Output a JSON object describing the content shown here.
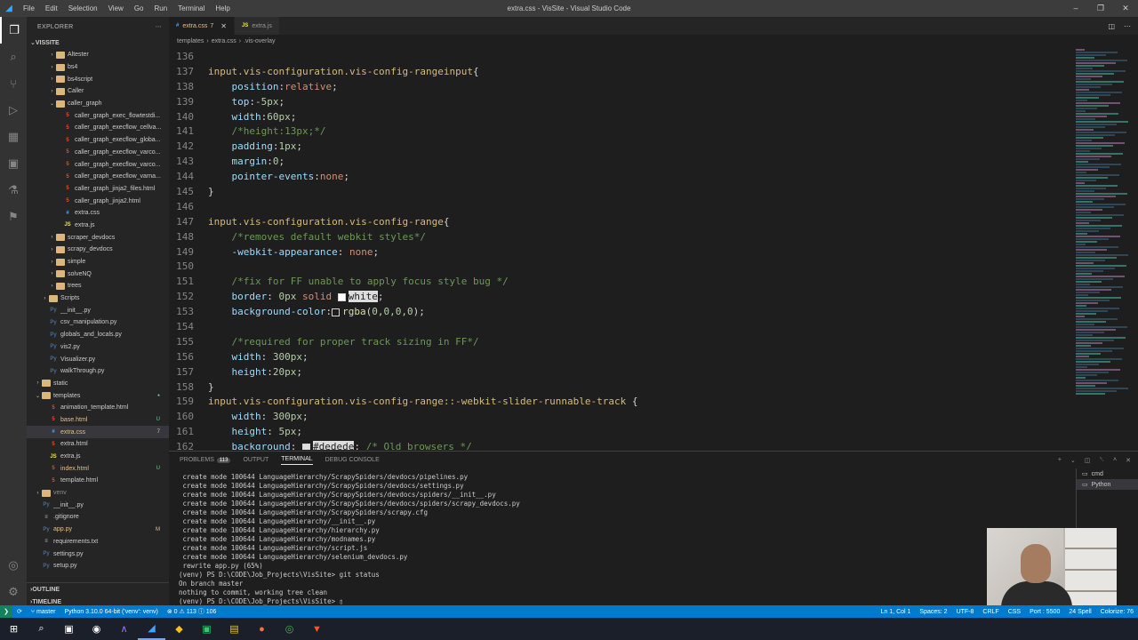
{
  "titlebar": {
    "menu": [
      "File",
      "Edit",
      "Selection",
      "View",
      "Go",
      "Run",
      "Terminal",
      "Help"
    ],
    "title": "extra.css - VisSite - Visual Studio Code"
  },
  "sidebar": {
    "header": "EXPLORER",
    "root": "VISSITE",
    "items": [
      {
        "label": "Altester",
        "type": "folder",
        "depth": 2,
        "status": ""
      },
      {
        "label": "bs4",
        "type": "folder",
        "depth": 2,
        "status": ""
      },
      {
        "label": "bs4script",
        "type": "folder",
        "depth": 2,
        "status": ""
      },
      {
        "label": "Caller",
        "type": "folder",
        "depth": 2,
        "status": ""
      },
      {
        "label": "caller_graph",
        "type": "folder-open",
        "depth": 2,
        "status": ""
      },
      {
        "label": "caller_graph_exec_flowtestdi...",
        "type": "html",
        "depth": 3,
        "status": ""
      },
      {
        "label": "caller_graph_execflow_cellva...",
        "type": "html",
        "depth": 3,
        "status": ""
      },
      {
        "label": "caller_graph_execflow_globa...",
        "type": "html",
        "depth": 3,
        "status": ""
      },
      {
        "label": "caller_graph_execflow_varco...",
        "type": "html",
        "depth": 3,
        "status": ""
      },
      {
        "label": "caller_graph_execflow_varco...",
        "type": "html",
        "depth": 3,
        "status": ""
      },
      {
        "label": "caller_graph_execflow_varna...",
        "type": "html",
        "depth": 3,
        "status": ""
      },
      {
        "label": "caller_graph_jinja2_files.html",
        "type": "html",
        "depth": 3,
        "status": ""
      },
      {
        "label": "caller_graph_jinja2.html",
        "type": "html",
        "depth": 3,
        "status": ""
      },
      {
        "label": "extra.css",
        "type": "css",
        "depth": 3,
        "status": ""
      },
      {
        "label": "extra.js",
        "type": "js",
        "depth": 3,
        "status": ""
      },
      {
        "label": "scraper_devdocs",
        "type": "folder",
        "depth": 2,
        "status": ""
      },
      {
        "label": "scrapy_devdocs",
        "type": "folder",
        "depth": 2,
        "status": ""
      },
      {
        "label": "simple",
        "type": "folder",
        "depth": 2,
        "status": ""
      },
      {
        "label": "solveNQ",
        "type": "folder",
        "depth": 2,
        "status": ""
      },
      {
        "label": "trees",
        "type": "folder",
        "depth": 2,
        "status": ""
      },
      {
        "label": "Scripts",
        "type": "folder",
        "depth": 1,
        "status": ""
      },
      {
        "label": "__init__.py",
        "type": "py",
        "depth": 1,
        "status": ""
      },
      {
        "label": "csv_manipulation.py",
        "type": "py",
        "depth": 1,
        "status": ""
      },
      {
        "label": "globals_and_locals.py",
        "type": "py",
        "depth": 1,
        "status": ""
      },
      {
        "label": "vis2.py",
        "type": "py",
        "depth": 1,
        "status": ""
      },
      {
        "label": "Visualizer.py",
        "type": "py",
        "depth": 1,
        "status": ""
      },
      {
        "label": "walkThrough.py",
        "type": "py",
        "depth": 1,
        "status": ""
      },
      {
        "label": "static",
        "type": "folder",
        "depth": 0,
        "status": ""
      },
      {
        "label": "templates",
        "type": "folder-open",
        "depth": 0,
        "status": "dot"
      },
      {
        "label": "animation_template.html",
        "type": "html",
        "depth": 1,
        "status": ""
      },
      {
        "label": "base.html",
        "type": "html",
        "depth": 1,
        "status": "U"
      },
      {
        "label": "extra.css",
        "type": "css",
        "depth": 1,
        "status": "7",
        "selected": true
      },
      {
        "label": "extra.html",
        "type": "html",
        "depth": 1,
        "status": ""
      },
      {
        "label": "extra.js",
        "type": "js",
        "depth": 1,
        "status": ""
      },
      {
        "label": "index.html",
        "type": "html",
        "depth": 1,
        "status": "U"
      },
      {
        "label": "template.html",
        "type": "html",
        "depth": 1,
        "status": ""
      },
      {
        "label": "venv",
        "type": "folder",
        "depth": 0,
        "status": ""
      },
      {
        "label": "__init__.py",
        "type": "py",
        "depth": 0,
        "status": ""
      },
      {
        "label": ".gitignore",
        "type": "txt",
        "depth": 0,
        "status": ""
      },
      {
        "label": "app.py",
        "type": "py",
        "depth": 0,
        "status": "M"
      },
      {
        "label": "requirements.txt",
        "type": "txt",
        "depth": 0,
        "status": ""
      },
      {
        "label": "settings.py",
        "type": "py",
        "depth": 0,
        "status": ""
      },
      {
        "label": "setup.py",
        "type": "py",
        "depth": 0,
        "status": ""
      }
    ],
    "outline": "OUTLINE",
    "timeline": "TIMELINE"
  },
  "tabs": [
    {
      "label": "extra.css",
      "suffix": "7",
      "icon": "#",
      "active": true
    },
    {
      "label": "extra.js",
      "suffix": "",
      "icon": "JS",
      "active": false
    }
  ],
  "breadcrumb": [
    "templates",
    ">",
    "extra.css",
    ">",
    ".vis-overlay"
  ],
  "code": {
    "lines": [
      {
        "n": "136",
        "parts": []
      },
      {
        "n": "137",
        "parts": [
          [
            "c-sel",
            "input.vis-configuration.vis-config-rangeinput"
          ],
          [
            "c-punc",
            "{"
          ]
        ]
      },
      {
        "n": "138",
        "parts": [
          [
            "c-punc",
            "    "
          ],
          [
            "c-prop",
            "position"
          ],
          [
            "c-punc",
            ":"
          ],
          [
            "c-val",
            "relative"
          ],
          [
            "c-punc",
            ";"
          ]
        ]
      },
      {
        "n": "139",
        "parts": [
          [
            "c-punc",
            "    "
          ],
          [
            "c-prop",
            "top"
          ],
          [
            "c-punc",
            ":"
          ],
          [
            "c-num",
            "-5px"
          ],
          [
            "c-punc",
            ";"
          ]
        ]
      },
      {
        "n": "140",
        "parts": [
          [
            "c-punc",
            "    "
          ],
          [
            "c-prop",
            "width"
          ],
          [
            "c-punc",
            ":"
          ],
          [
            "c-num",
            "60px"
          ],
          [
            "c-punc",
            ";"
          ]
        ]
      },
      {
        "n": "141",
        "parts": [
          [
            "c-punc",
            "    "
          ],
          [
            "c-com",
            "/*height:13px;*/"
          ]
        ]
      },
      {
        "n": "142",
        "parts": [
          [
            "c-punc",
            "    "
          ],
          [
            "c-prop",
            "padding"
          ],
          [
            "c-punc",
            ":"
          ],
          [
            "c-num",
            "1px"
          ],
          [
            "c-punc",
            ";"
          ]
        ]
      },
      {
        "n": "143",
        "parts": [
          [
            "c-punc",
            "    "
          ],
          [
            "c-prop",
            "margin"
          ],
          [
            "c-punc",
            ":"
          ],
          [
            "c-num",
            "0"
          ],
          [
            "c-punc",
            ";"
          ]
        ]
      },
      {
        "n": "144",
        "parts": [
          [
            "c-punc",
            "    "
          ],
          [
            "c-prop",
            "pointer-events"
          ],
          [
            "c-punc",
            ":"
          ],
          [
            "c-val",
            "none"
          ],
          [
            "c-punc",
            ";"
          ]
        ]
      },
      {
        "n": "145",
        "parts": [
          [
            "c-punc",
            "}"
          ]
        ]
      },
      {
        "n": "146",
        "parts": []
      },
      {
        "n": "147",
        "parts": [
          [
            "c-sel",
            "input.vis-configuration.vis-config-range"
          ],
          [
            "c-punc",
            "{"
          ]
        ]
      },
      {
        "n": "148",
        "parts": [
          [
            "c-punc",
            "    "
          ],
          [
            "c-com",
            "/*removes default webkit styles*/"
          ]
        ]
      },
      {
        "n": "149",
        "parts": [
          [
            "c-punc",
            "    "
          ],
          [
            "c-prop",
            "-webkit-appearance"
          ],
          [
            "c-punc",
            ": "
          ],
          [
            "c-val",
            "none"
          ],
          [
            "c-punc",
            ";"
          ]
        ]
      },
      {
        "n": "150",
        "parts": []
      },
      {
        "n": "151",
        "parts": [
          [
            "c-punc",
            "    "
          ],
          [
            "c-com",
            "/*fix for FF unable to apply focus style bug */"
          ]
        ]
      },
      {
        "n": "152",
        "parts": [
          [
            "c-punc",
            "    "
          ],
          [
            "c-prop",
            "border"
          ],
          [
            "c-punc",
            ": "
          ],
          [
            "c-num",
            "0px"
          ],
          [
            "c-punc",
            " "
          ],
          [
            "c-val",
            "solid"
          ],
          [
            "c-punc",
            " "
          ],
          [
            "swatch-white",
            ""
          ],
          [
            "hl",
            "white"
          ],
          [
            "c-punc",
            ";"
          ]
        ]
      },
      {
        "n": "153",
        "parts": [
          [
            "c-punc",
            "    "
          ],
          [
            "c-prop",
            "background-color"
          ],
          [
            "c-punc",
            ":"
          ],
          [
            "swatch-clear",
            ""
          ],
          [
            "c-fn",
            "rgba"
          ],
          [
            "c-punc",
            "("
          ],
          [
            "c-num",
            "0,0,0,0"
          ],
          [
            "c-punc",
            ");"
          ]
        ]
      },
      {
        "n": "154",
        "parts": []
      },
      {
        "n": "155",
        "parts": [
          [
            "c-punc",
            "    "
          ],
          [
            "c-com",
            "/*required for proper track sizing in FF*/"
          ]
        ]
      },
      {
        "n": "156",
        "parts": [
          [
            "c-punc",
            "    "
          ],
          [
            "c-prop",
            "width"
          ],
          [
            "c-punc",
            ": "
          ],
          [
            "c-num",
            "300px"
          ],
          [
            "c-punc",
            ";"
          ]
        ]
      },
      {
        "n": "157",
        "parts": [
          [
            "c-punc",
            "    "
          ],
          [
            "c-prop",
            "height"
          ],
          [
            "c-punc",
            ":"
          ],
          [
            "c-num",
            "20px"
          ],
          [
            "c-punc",
            ";"
          ]
        ]
      },
      {
        "n": "158",
        "parts": [
          [
            "c-punc",
            "}"
          ]
        ]
      },
      {
        "n": "159",
        "parts": [
          [
            "c-sel",
            "input.vis-configuration.vis-config-range::-webkit-slider-runnable-track"
          ],
          [
            "c-punc",
            " {"
          ]
        ]
      },
      {
        "n": "160",
        "parts": [
          [
            "c-punc",
            "    "
          ],
          [
            "c-prop",
            "width"
          ],
          [
            "c-punc",
            ": "
          ],
          [
            "c-num",
            "300px"
          ],
          [
            "c-punc",
            ";"
          ]
        ]
      },
      {
        "n": "161",
        "parts": [
          [
            "c-punc",
            "    "
          ],
          [
            "c-prop",
            "height"
          ],
          [
            "c-punc",
            ": "
          ],
          [
            "c-num",
            "5px"
          ],
          [
            "c-punc",
            ";"
          ]
        ]
      },
      {
        "n": "162",
        "parts": [
          [
            "c-punc",
            "    "
          ],
          [
            "c-prop",
            "background"
          ],
          [
            "c-punc",
            ": "
          ],
          [
            "swatch-grey",
            ""
          ],
          [
            "hl",
            "#dedede"
          ],
          [
            "c-punc",
            "; "
          ],
          [
            "c-com",
            "/* Old browsers */"
          ]
        ]
      }
    ]
  },
  "panel": {
    "tabs": [
      "PROBLEMS",
      "OUTPUT",
      "TERMINAL",
      "DEBUG CONSOLE"
    ],
    "problems_count": "113",
    "active_tab": "TERMINAL",
    "terminal_lines": [
      " create mode 100644 LanguageHierarchy/ScrapySpiders/devdocs/pipelines.py",
      " create mode 100644 LanguageHierarchy/ScrapySpiders/devdocs/settings.py",
      " create mode 100644 LanguageHierarchy/ScrapySpiders/devdocs/spiders/__init__.py",
      " create mode 100644 LanguageHierarchy/ScrapySpiders/devdocs/spiders/scrapy_devdocs.py",
      " create mode 100644 LanguageHierarchy/ScrapySpiders/scrapy.cfg",
      " create mode 100644 LanguageHierarchy/__init__.py",
      " create mode 100644 LanguageHierarchy/hierarchy.py",
      " create mode 100644 LanguageHierarchy/modnames.py",
      " create mode 100644 LanguageHierarchy/script.js",
      " create mode 100644 LanguageHierarchy/selenium_devdocs.py",
      " rewrite app.py (65%)",
      "(venv) PS D:\\CODE\\Job_Projects\\VisSite> git status",
      "On branch master",
      "nothing to commit, working tree clean",
      "(venv) PS D:\\CODE\\Job_Projects\\VisSite> "
    ],
    "terminals": [
      "cmd",
      "Python"
    ]
  },
  "statusbar": {
    "left": [
      "master",
      "Python 3.10.0 64-bit ('venv': venv)",
      "⊗ 0 ⚠ 113 ⓘ 106"
    ],
    "right": [
      "Ln 1, Col 1",
      "Spaces: 2",
      "UTF-8",
      "CRLF",
      "CSS",
      "Port : 5500",
      "24 Spell",
      "Colorize: 76"
    ]
  },
  "colors": {
    "statusbar": "#007acc",
    "accent": "#3ea6ff"
  }
}
